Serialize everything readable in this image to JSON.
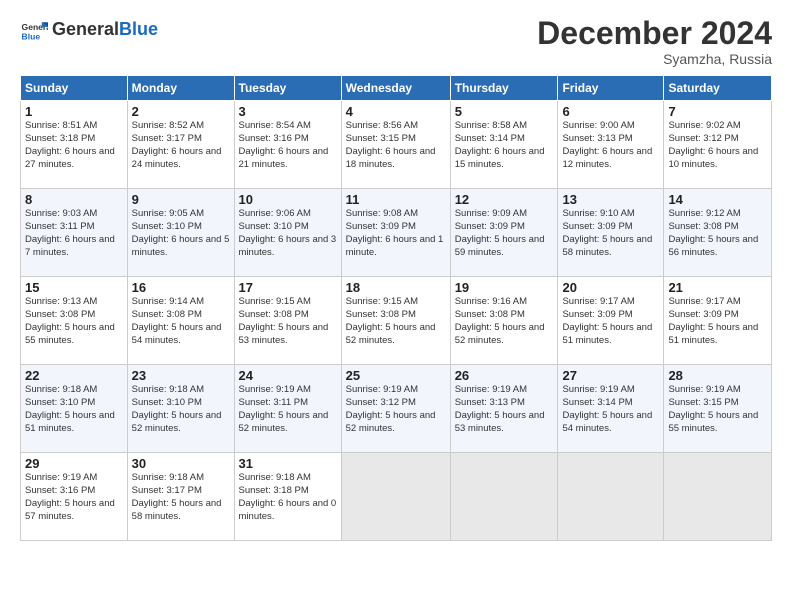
{
  "header": {
    "logo_text_general": "General",
    "logo_text_blue": "Blue",
    "month_title": "December 2024",
    "subtitle": "Syamzha, Russia"
  },
  "weekdays": [
    "Sunday",
    "Monday",
    "Tuesday",
    "Wednesday",
    "Thursday",
    "Friday",
    "Saturday"
  ],
  "weeks": [
    [
      {
        "day": "1",
        "sunrise": "Sunrise: 8:51 AM",
        "sunset": "Sunset: 3:18 PM",
        "daylight": "Daylight: 6 hours and 27 minutes."
      },
      {
        "day": "2",
        "sunrise": "Sunrise: 8:52 AM",
        "sunset": "Sunset: 3:17 PM",
        "daylight": "Daylight: 6 hours and 24 minutes."
      },
      {
        "day": "3",
        "sunrise": "Sunrise: 8:54 AM",
        "sunset": "Sunset: 3:16 PM",
        "daylight": "Daylight: 6 hours and 21 minutes."
      },
      {
        "day": "4",
        "sunrise": "Sunrise: 8:56 AM",
        "sunset": "Sunset: 3:15 PM",
        "daylight": "Daylight: 6 hours and 18 minutes."
      },
      {
        "day": "5",
        "sunrise": "Sunrise: 8:58 AM",
        "sunset": "Sunset: 3:14 PM",
        "daylight": "Daylight: 6 hours and 15 minutes."
      },
      {
        "day": "6",
        "sunrise": "Sunrise: 9:00 AM",
        "sunset": "Sunset: 3:13 PM",
        "daylight": "Daylight: 6 hours and 12 minutes."
      },
      {
        "day": "7",
        "sunrise": "Sunrise: 9:02 AM",
        "sunset": "Sunset: 3:12 PM",
        "daylight": "Daylight: 6 hours and 10 minutes."
      }
    ],
    [
      {
        "day": "8",
        "sunrise": "Sunrise: 9:03 AM",
        "sunset": "Sunset: 3:11 PM",
        "daylight": "Daylight: 6 hours and 7 minutes."
      },
      {
        "day": "9",
        "sunrise": "Sunrise: 9:05 AM",
        "sunset": "Sunset: 3:10 PM",
        "daylight": "Daylight: 6 hours and 5 minutes."
      },
      {
        "day": "10",
        "sunrise": "Sunrise: 9:06 AM",
        "sunset": "Sunset: 3:10 PM",
        "daylight": "Daylight: 6 hours and 3 minutes."
      },
      {
        "day": "11",
        "sunrise": "Sunrise: 9:08 AM",
        "sunset": "Sunset: 3:09 PM",
        "daylight": "Daylight: 6 hours and 1 minute."
      },
      {
        "day": "12",
        "sunrise": "Sunrise: 9:09 AM",
        "sunset": "Sunset: 3:09 PM",
        "daylight": "Daylight: 5 hours and 59 minutes."
      },
      {
        "day": "13",
        "sunrise": "Sunrise: 9:10 AM",
        "sunset": "Sunset: 3:09 PM",
        "daylight": "Daylight: 5 hours and 58 minutes."
      },
      {
        "day": "14",
        "sunrise": "Sunrise: 9:12 AM",
        "sunset": "Sunset: 3:08 PM",
        "daylight": "Daylight: 5 hours and 56 minutes."
      }
    ],
    [
      {
        "day": "15",
        "sunrise": "Sunrise: 9:13 AM",
        "sunset": "Sunset: 3:08 PM",
        "daylight": "Daylight: 5 hours and 55 minutes."
      },
      {
        "day": "16",
        "sunrise": "Sunrise: 9:14 AM",
        "sunset": "Sunset: 3:08 PM",
        "daylight": "Daylight: 5 hours and 54 minutes."
      },
      {
        "day": "17",
        "sunrise": "Sunrise: 9:15 AM",
        "sunset": "Sunset: 3:08 PM",
        "daylight": "Daylight: 5 hours and 53 minutes."
      },
      {
        "day": "18",
        "sunrise": "Sunrise: 9:15 AM",
        "sunset": "Sunset: 3:08 PM",
        "daylight": "Daylight: 5 hours and 52 minutes."
      },
      {
        "day": "19",
        "sunrise": "Sunrise: 9:16 AM",
        "sunset": "Sunset: 3:08 PM",
        "daylight": "Daylight: 5 hours and 52 minutes."
      },
      {
        "day": "20",
        "sunrise": "Sunrise: 9:17 AM",
        "sunset": "Sunset: 3:09 PM",
        "daylight": "Daylight: 5 hours and 51 minutes."
      },
      {
        "day": "21",
        "sunrise": "Sunrise: 9:17 AM",
        "sunset": "Sunset: 3:09 PM",
        "daylight": "Daylight: 5 hours and 51 minutes."
      }
    ],
    [
      {
        "day": "22",
        "sunrise": "Sunrise: 9:18 AM",
        "sunset": "Sunset: 3:10 PM",
        "daylight": "Daylight: 5 hours and 51 minutes."
      },
      {
        "day": "23",
        "sunrise": "Sunrise: 9:18 AM",
        "sunset": "Sunset: 3:10 PM",
        "daylight": "Daylight: 5 hours and 52 minutes."
      },
      {
        "day": "24",
        "sunrise": "Sunrise: 9:19 AM",
        "sunset": "Sunset: 3:11 PM",
        "daylight": "Daylight: 5 hours and 52 minutes."
      },
      {
        "day": "25",
        "sunrise": "Sunrise: 9:19 AM",
        "sunset": "Sunset: 3:12 PM",
        "daylight": "Daylight: 5 hours and 52 minutes."
      },
      {
        "day": "26",
        "sunrise": "Sunrise: 9:19 AM",
        "sunset": "Sunset: 3:13 PM",
        "daylight": "Daylight: 5 hours and 53 minutes."
      },
      {
        "day": "27",
        "sunrise": "Sunrise: 9:19 AM",
        "sunset": "Sunset: 3:14 PM",
        "daylight": "Daylight: 5 hours and 54 minutes."
      },
      {
        "day": "28",
        "sunrise": "Sunrise: 9:19 AM",
        "sunset": "Sunset: 3:15 PM",
        "daylight": "Daylight: 5 hours and 55 minutes."
      }
    ],
    [
      {
        "day": "29",
        "sunrise": "Sunrise: 9:19 AM",
        "sunset": "Sunset: 3:16 PM",
        "daylight": "Daylight: 5 hours and 57 minutes."
      },
      {
        "day": "30",
        "sunrise": "Sunrise: 9:18 AM",
        "sunset": "Sunset: 3:17 PM",
        "daylight": "Daylight: 5 hours and 58 minutes."
      },
      {
        "day": "31",
        "sunrise": "Sunrise: 9:18 AM",
        "sunset": "Sunset: 3:18 PM",
        "daylight": "Daylight: 6 hours and 0 minutes."
      },
      null,
      null,
      null,
      null
    ]
  ]
}
